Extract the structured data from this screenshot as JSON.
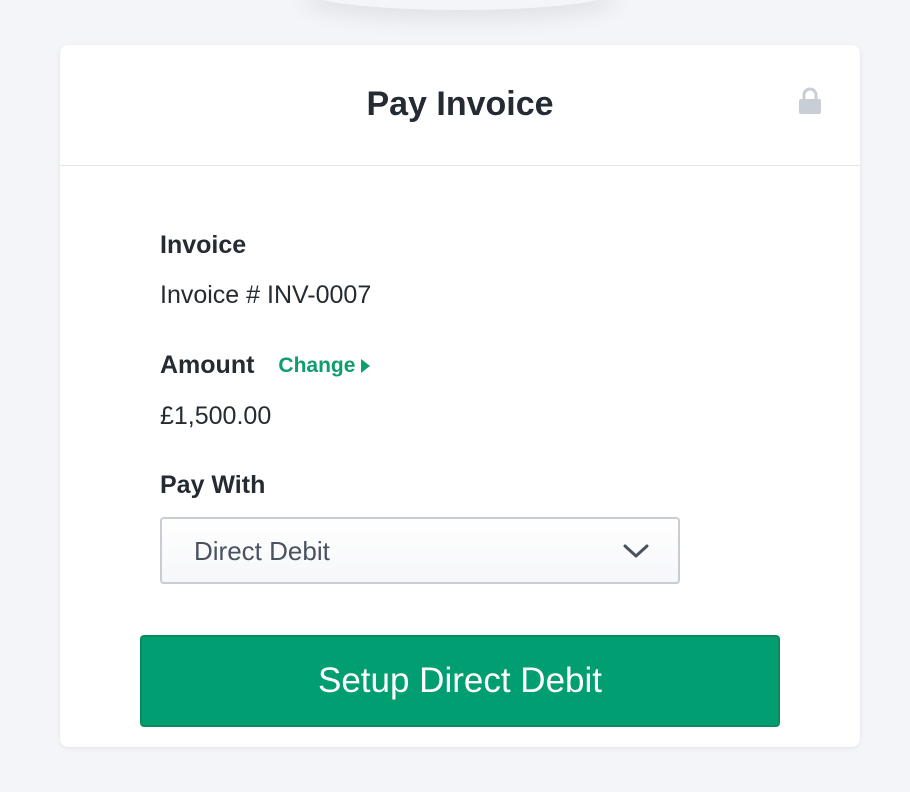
{
  "header": {
    "title": "Pay Invoice",
    "lock_icon": "lock-icon"
  },
  "invoice": {
    "label": "Invoice",
    "value": "Invoice # INV-0007"
  },
  "amount": {
    "label": "Amount",
    "change_label": "Change",
    "value": "£1,500.00"
  },
  "pay_with": {
    "label": "Pay With",
    "selected": "Direct Debit",
    "dropdown_icon": "chevron-down-icon"
  },
  "actions": {
    "submit_label": "Setup Direct Debit"
  },
  "colors": {
    "accent": "#009e70",
    "link": "#0f9d6b",
    "text": "#252b33",
    "background": "#f4f5f9"
  }
}
